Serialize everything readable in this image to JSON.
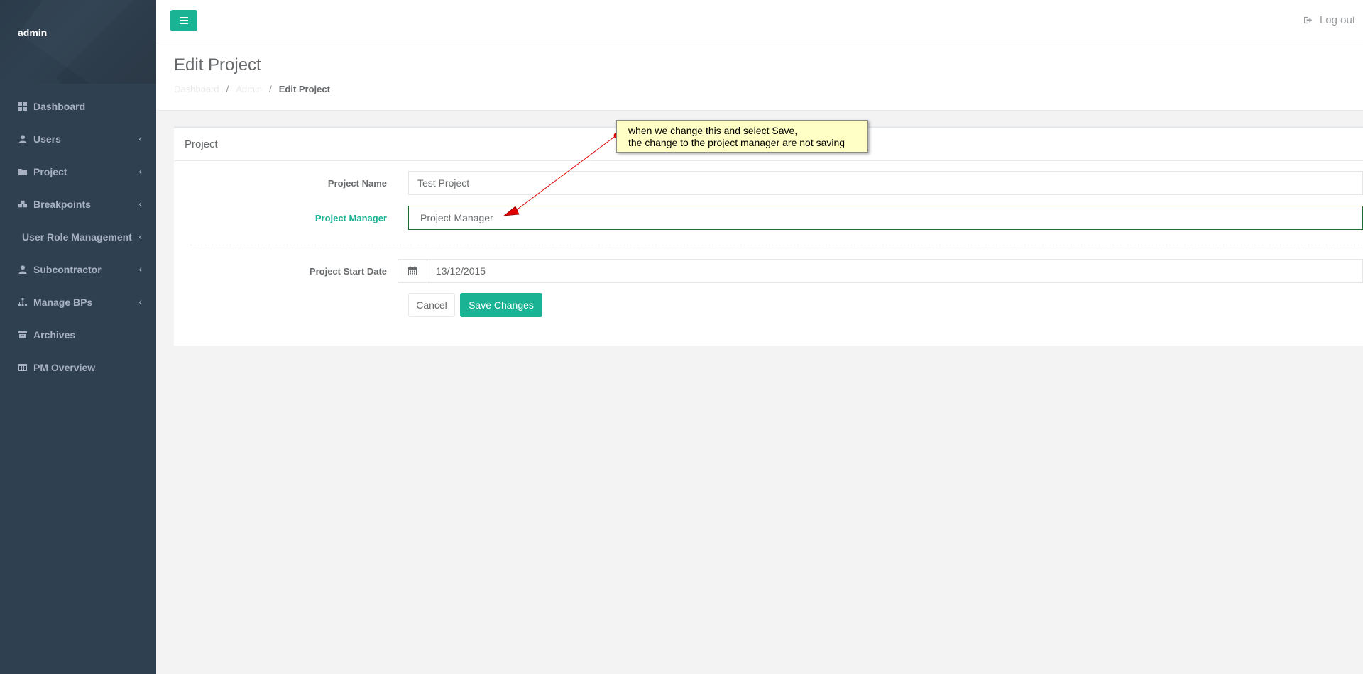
{
  "sidebar": {
    "user": "admin",
    "items": [
      {
        "label": "Dashboard",
        "icon": "dashboard-icon",
        "chevron": false
      },
      {
        "label": "Users",
        "icon": "user-icon",
        "chevron": true
      },
      {
        "label": "Project",
        "icon": "folder-icon",
        "chevron": true
      },
      {
        "label": "Breakpoints",
        "icon": "cubes-icon",
        "chevron": true
      },
      {
        "label": "User Role Management",
        "icon": "",
        "chevron": true
      },
      {
        "label": "Subcontractor",
        "icon": "user-icon",
        "chevron": true
      },
      {
        "label": "Manage BPs",
        "icon": "sitemap-icon",
        "chevron": true
      },
      {
        "label": "Archives",
        "icon": "archive-icon",
        "chevron": false
      },
      {
        "label": "PM Overview",
        "icon": "table-icon",
        "chevron": false
      }
    ]
  },
  "topbar": {
    "logout_label": "Log out"
  },
  "heading": {
    "title": "Edit Project",
    "breadcrumb": [
      "Dashboard",
      "Admin",
      "Edit Project"
    ]
  },
  "panel": {
    "title": "Project",
    "project_name_label": "Project Name",
    "project_name_value": "Test Project",
    "project_manager_label": "Project Manager",
    "project_manager_value": "Project Manager",
    "start_date_label": "Project Start Date",
    "start_date_value": "13/12/2015",
    "cancel_label": "Cancel",
    "save_label": "Save Changes"
  },
  "annotation": {
    "line1": "when we change this and select Save,",
    "line2": "the change to the project manager are not saving"
  },
  "colors": {
    "accent": "#1ab394",
    "sidebar": "#2f4050",
    "annotation_bg": "#ffffc6",
    "arrow": "#e00000"
  }
}
